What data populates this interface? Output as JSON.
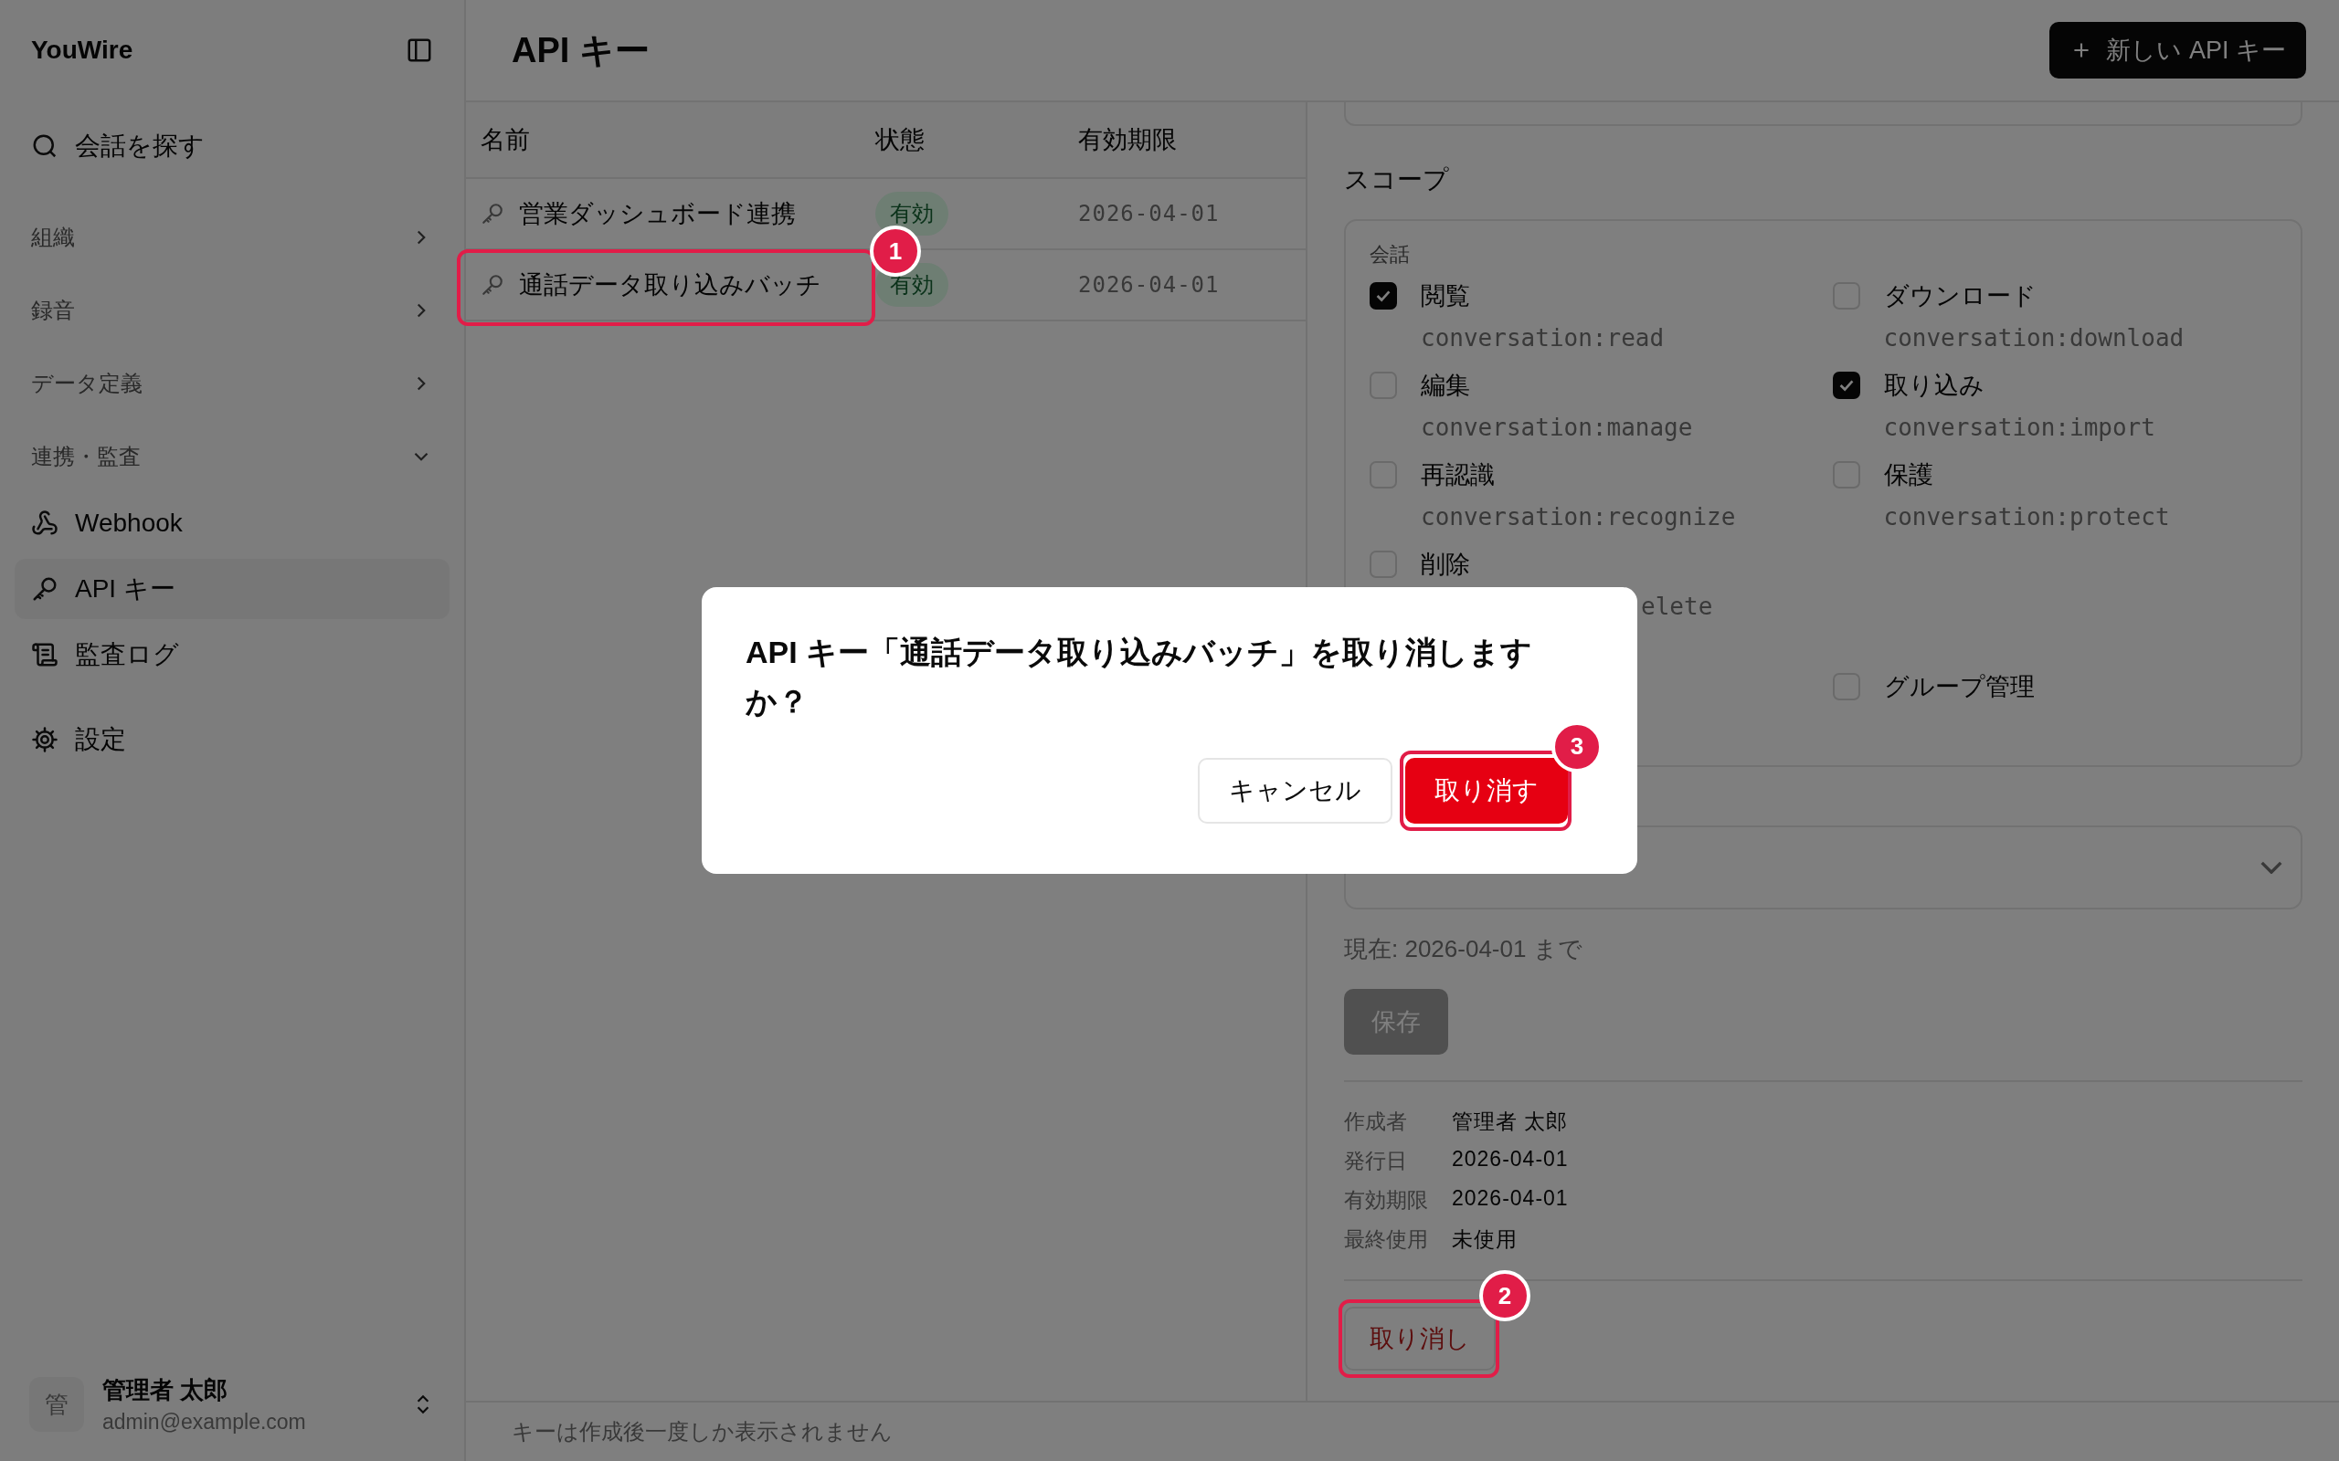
{
  "sidebar": {
    "brand": "YouWire",
    "search_label": "会話を探す",
    "groups": [
      {
        "label": "組織",
        "expanded": false
      },
      {
        "label": "録音",
        "expanded": false
      },
      {
        "label": "データ定義",
        "expanded": false
      },
      {
        "label": "連携・監査",
        "expanded": true,
        "children": [
          {
            "label": "Webhook",
            "kind": "webhook",
            "selected": false
          },
          {
            "label": "API キー",
            "kind": "key",
            "selected": true
          },
          {
            "label": "監査ログ",
            "kind": "log",
            "selected": false
          }
        ]
      }
    ],
    "settings_label": "設定",
    "user": {
      "avatar": "管",
      "name": "管理者 太郎",
      "email": "admin@example.com"
    }
  },
  "page": {
    "title": "API キー",
    "new_button": "新しい API キー"
  },
  "table": {
    "columns": [
      "名前",
      "状態",
      "有効期限"
    ],
    "rows": [
      {
        "name": "営業ダッシュボード連携",
        "status": "有効",
        "expires": "2026-04-01"
      },
      {
        "name": "通話データ取り込みバッチ",
        "status": "有効",
        "expires": "2026-04-01",
        "callout": "1"
      }
    ]
  },
  "detail": {
    "scope_title": "スコープ",
    "scope_groups": [
      {
        "label": "会話",
        "items": [
          {
            "label": "閲覧",
            "code": "conversation:read",
            "checked": true
          },
          {
            "label": "ダウンロード",
            "code": "conversation:download",
            "checked": false
          },
          {
            "label": "編集",
            "code": "conversation:manage",
            "checked": false
          },
          {
            "label": "取り込み",
            "code": "conversation:import",
            "checked": true
          },
          {
            "label": "再認識",
            "code": "conversation:recognize",
            "checked": false
          },
          {
            "label": "保護",
            "code": "conversation:protect",
            "checked": false
          },
          {
            "label": "削除",
            "code": "elete",
            "code_clipped": true,
            "checked": false
          }
        ]
      },
      {
        "items": [
          {
            "label": "グループ管理",
            "checked": false
          }
        ]
      }
    ],
    "expiry_hint": "現在: 2026-04-01 まで",
    "save_button": {
      "label": "保存",
      "disabled": true
    },
    "meta": [
      {
        "label": "作成者",
        "value": "管理者 太郎"
      },
      {
        "label": "発行日",
        "value": "2026-04-01"
      },
      {
        "label": "有効期限",
        "value": "2026-04-01"
      },
      {
        "label": "最終使用",
        "value": "未使用"
      }
    ],
    "revoke_button": {
      "label": "取り消し",
      "callout": "2"
    }
  },
  "footer_note": "キーは作成後一度しか表示されません",
  "dialog": {
    "message": "API キー「通話データ取り込みバッチ」を取り消しますか？",
    "buttons": [
      {
        "label": "キャンセル",
        "kind": "secondary"
      },
      {
        "label": "取り消す",
        "kind": "danger",
        "callout": "3"
      }
    ]
  }
}
